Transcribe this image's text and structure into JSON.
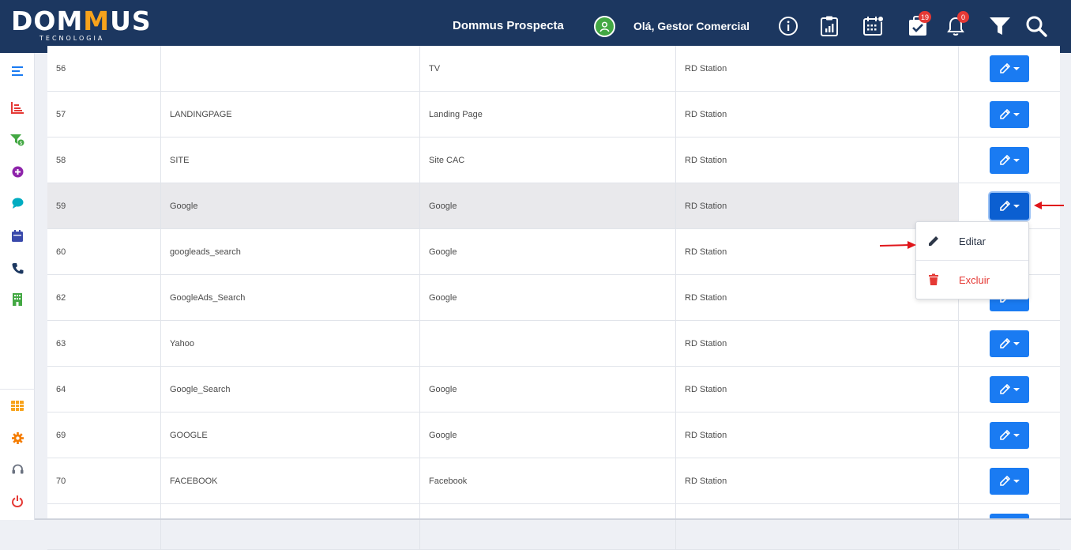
{
  "header": {
    "logo_text_pre": "DOM",
    "logo_text_m": "M",
    "logo_text_post": "US",
    "logo_sub": "TECNOLOGIA",
    "app_title": "Dommus Prospecta",
    "greeting": "Olá, Gestor Comercial",
    "tasks_badge": "19",
    "notifications_badge": "0",
    "icons": [
      "user-avatar-icon",
      "info-icon",
      "report-icon",
      "calendar-icon",
      "tasks-icon",
      "bell-icon",
      "filter-icon",
      "search-icon"
    ]
  },
  "sidebar": {
    "items": [
      {
        "name": "menu-icon",
        "color": "#1a7bf2"
      },
      {
        "name": "chart-icon",
        "color": "#e53935"
      },
      {
        "name": "funnel-dollar-icon",
        "color": "#43a843"
      },
      {
        "name": "plus-circle-icon",
        "color": "#8e24aa"
      },
      {
        "name": "chat-icon",
        "color": "#00acc1"
      },
      {
        "name": "calendar-icon",
        "color": "#3949ab"
      },
      {
        "name": "phone-icon",
        "color": "#1c3760"
      },
      {
        "name": "building-icon",
        "color": "#43a843"
      },
      {
        "name": "grid-icon",
        "color": "#f7a31c"
      },
      {
        "name": "gear-icon",
        "color": "#f57c00"
      },
      {
        "name": "headset-icon",
        "color": "#6b7280"
      },
      {
        "name": "power-icon",
        "color": "#e53935"
      }
    ]
  },
  "table": {
    "rows": [
      {
        "id": "56",
        "name": "",
        "type": "TV",
        "source": "RD Station"
      },
      {
        "id": "57",
        "name": "LANDINGPAGE",
        "type": "Landing Page",
        "source": "RD Station"
      },
      {
        "id": "58",
        "name": "SITE",
        "type": "Site CAC",
        "source": "RD Station"
      },
      {
        "id": "59",
        "name": "Google",
        "type": "Google",
        "source": "RD Station"
      },
      {
        "id": "60",
        "name": "googleads_search",
        "type": "Google",
        "source": "RD Station"
      },
      {
        "id": "62",
        "name": "GoogleAds_Search",
        "type": "Google",
        "source": "RD Station"
      },
      {
        "id": "63",
        "name": "Yahoo",
        "type": "",
        "source": "RD Station"
      },
      {
        "id": "64",
        "name": "Google_Search",
        "type": "Google",
        "source": "RD Station"
      },
      {
        "id": "69",
        "name": "GOOGLE",
        "type": "Google",
        "source": "RD Station"
      },
      {
        "id": "70",
        "name": "FACEBOOK",
        "type": "Facebook",
        "source": "RD Station"
      },
      {
        "id": "",
        "name": "",
        "type": "",
        "source": ""
      }
    ]
  },
  "dropdown": {
    "edit_label": "Editar",
    "delete_label": "Excluir"
  },
  "colors": {
    "header_bg": "#1c3760",
    "accent": "#1a7bf2",
    "brand_orange": "#f7a31c",
    "danger": "#e53935"
  }
}
